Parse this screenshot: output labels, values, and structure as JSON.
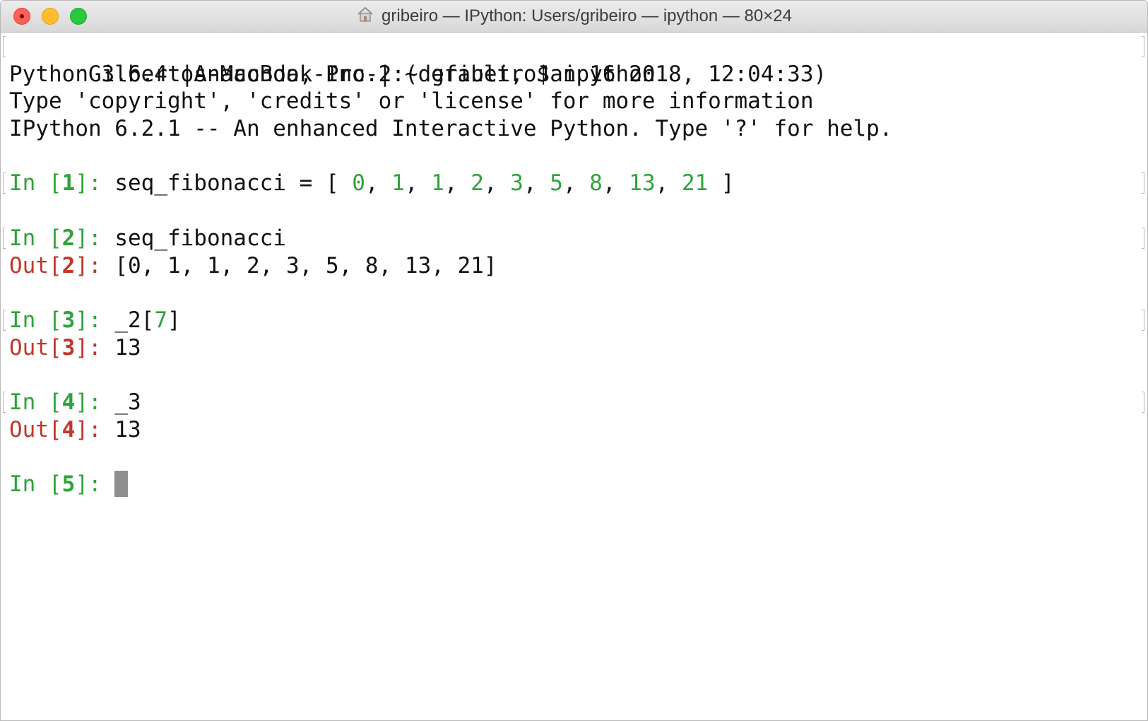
{
  "window": {
    "title": "gribeiro — IPython: Users/gribeiro — ipython — 80×24",
    "home_icon": "house-icon"
  },
  "colors": {
    "prompt_in": "#2ea43a",
    "prompt_out": "#c2362b",
    "text": "#111111",
    "cursor": "#8e8e8e"
  },
  "terminal": {
    "shell_prompt": "Gilbertos-MacBook-Pro-2:~ gribeiro$ ipython",
    "banner_lines": [
      "Python 3.6.4 |Anaconda, Inc.| (default, Jan 16 2018, 12:04:33)",
      "Type 'copyright', 'credits' or 'license' for more information",
      "IPython 6.2.1 -- An enhanced Interactive Python. Type '?' for help."
    ],
    "cells": [
      {
        "in_label": "In [",
        "in_num": "1",
        "in_close": "]: ",
        "code_prefix": "seq_fibonacci = [ ",
        "code_numbers": [
          "0",
          "1",
          "1",
          "2",
          "3",
          "5",
          "8",
          "13",
          "21"
        ],
        "code_suffix": " ]"
      },
      {
        "in_label": "In [",
        "in_num": "2",
        "in_close": "]: ",
        "code": "seq_fibonacci",
        "out_label": "Out[",
        "out_num": "2",
        "out_close": "]: ",
        "output": "[0, 1, 1, 2, 3, 5, 8, 13, 21]"
      },
      {
        "in_label": "In [",
        "in_num": "3",
        "in_close": "]: ",
        "code_a": "_2[",
        "code_idx": "7",
        "code_b": "]",
        "out_label": "Out[",
        "out_num": "3",
        "out_close": "]: ",
        "output": "13"
      },
      {
        "in_label": "In [",
        "in_num": "4",
        "in_close": "]: ",
        "code": "_3",
        "out_label": "Out[",
        "out_num": "4",
        "out_close": "]: ",
        "output": "13"
      },
      {
        "in_label": "In [",
        "in_num": "5",
        "in_close": "]: "
      }
    ]
  }
}
